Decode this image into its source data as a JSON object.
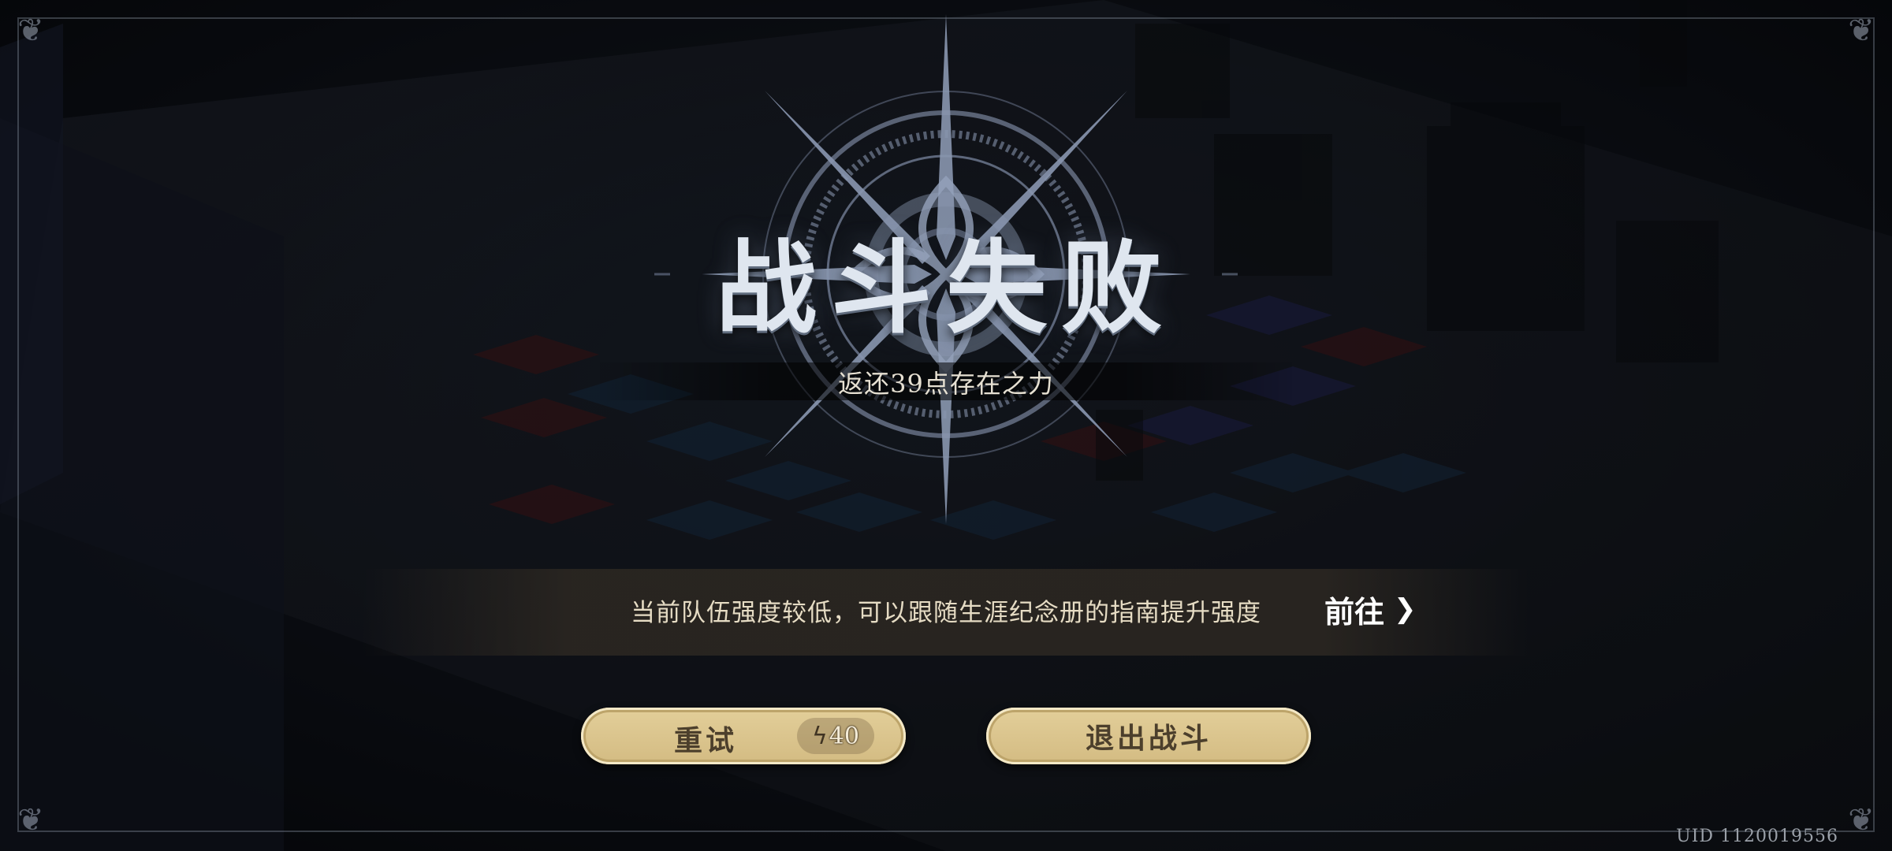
{
  "result": {
    "title": "战斗失败",
    "subtitle": "返还39点存在之力"
  },
  "hint": {
    "text": "当前队伍强度较低，可以跟随生涯纪念册的指南提升强度",
    "goto_label": "前往",
    "goto_icon": "chevron-right-icon"
  },
  "buttons": {
    "retry_label": "重试",
    "retry_cost": "40",
    "retry_cost_icon": "lightning-icon",
    "quit_label": "退出战斗"
  },
  "footer": {
    "uid": "UID 1120019556"
  },
  "colors": {
    "button_fill": "#dcc58d",
    "button_text": "#4c3f2c",
    "title_silver": "#dfe6ef",
    "background": "#0d1016"
  }
}
